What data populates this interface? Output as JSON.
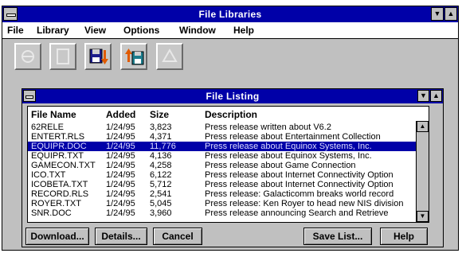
{
  "app": {
    "title": "File Libraries"
  },
  "menu": [
    "File",
    "Library",
    "View",
    "Options",
    "Window",
    "Help"
  ],
  "toolbar": {
    "buttons": [
      {
        "icon": "disabled-icon",
        "enabled": false
      },
      {
        "icon": "disabled-icon",
        "enabled": false
      },
      {
        "icon": "save-download-icon",
        "enabled": true
      },
      {
        "icon": "upload-icon",
        "enabled": true
      },
      {
        "icon": "disabled-icon",
        "enabled": false
      }
    ]
  },
  "listing": {
    "title": "File Listing",
    "columns": [
      "File Name",
      "Added",
      "Size",
      "Description"
    ],
    "selected_index": 2,
    "rows": [
      {
        "name": "62RELE",
        "added": "1/24/95",
        "size": "3,823",
        "desc": "Press release written about V6.2"
      },
      {
        "name": "ENTERT.RLS",
        "added": "1/24/95",
        "size": "4,371",
        "desc": "Press release about Entertainment Collection"
      },
      {
        "name": "EQUIPR.DOC",
        "added": "1/24/95",
        "size": "11,776",
        "desc": "Press release about Equinox Systems, Inc."
      },
      {
        "name": "EQUIPR.TXT",
        "added": "1/24/95",
        "size": "4,136",
        "desc": "Press release about Equinox Systems, Inc."
      },
      {
        "name": "GAMECON.TXT",
        "added": "1/24/95",
        "size": "4,258",
        "desc": "Press release about Game Connection"
      },
      {
        "name": "ICO.TXT",
        "added": "1/24/95",
        "size": "6,122",
        "desc": "Press release about Internet Connectivity Option"
      },
      {
        "name": "ICOBETA.TXT",
        "added": "1/24/95",
        "size": "5,712",
        "desc": "Press release about Internet Connectivity Option"
      },
      {
        "name": "RECORD.RLS",
        "added": "1/24/95",
        "size": "2,541",
        "desc": "Press release: Galacticomm breaks world record"
      },
      {
        "name": "ROYER.TXT",
        "added": "1/24/95",
        "size": "5,045",
        "desc": "Press release: Ken Royer to head new NIS division"
      },
      {
        "name": "SNR.DOC",
        "added": "1/24/95",
        "size": "3,960",
        "desc": "Press release announcing Search and Retrieve"
      }
    ]
  },
  "buttons": {
    "download": "Download...",
    "details": "Details...",
    "cancel": "Cancel",
    "save_list": "Save List...",
    "help": "Help"
  },
  "colors": {
    "titlebar": "#0000a8",
    "face": "#c0c0c0",
    "selection": "#0000a8"
  }
}
